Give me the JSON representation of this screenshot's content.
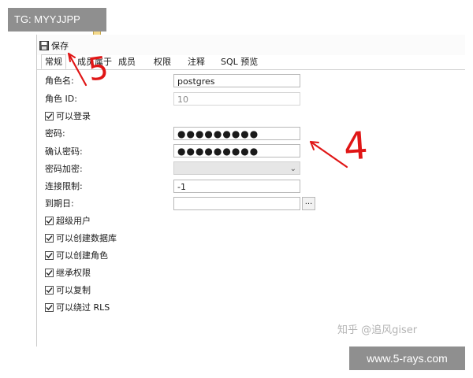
{
  "overlay": {
    "top_left_tag": "TG: MYYJJPP",
    "bottom_right_site": "www.5-rays.com",
    "zhihu_credit": "知乎 @追风giser"
  },
  "toolbar": {
    "save_label": "保存",
    "save_icon": "floppy-disk-icon"
  },
  "tabs": [
    {
      "label": "常规",
      "active": true
    },
    {
      "label": "成员属于",
      "active": false
    },
    {
      "label": "成员",
      "active": false
    },
    {
      "label": "权限",
      "active": false
    },
    {
      "label": "注释",
      "active": false
    },
    {
      "label": "SQL 预览",
      "active": false
    }
  ],
  "form": {
    "role_name_label": "角色名:",
    "role_name_value": "postgres",
    "role_id_label": "角色 ID:",
    "role_id_value": "10",
    "can_login_label": "可以登录",
    "password_label": "密码:",
    "password_value": "●●●●●●●●●",
    "confirm_password_label": "确认密码:",
    "confirm_password_value": "●●●●●●●●●",
    "password_encryption_label": "密码加密:",
    "password_encryption_value": "",
    "connection_limit_label": "连接限制:",
    "connection_limit_value": "-1",
    "expiry_label": "到期日:",
    "expiry_value": "",
    "expiry_button": "...",
    "checkboxes": [
      {
        "label": "超级用户",
        "checked": true
      },
      {
        "label": "可以创建数据库",
        "checked": true
      },
      {
        "label": "可以创建角色",
        "checked": true
      },
      {
        "label": "继承权限",
        "checked": true
      },
      {
        "label": "可以复制",
        "checked": true
      },
      {
        "label": "可以绕过 RLS",
        "checked": true
      }
    ]
  },
  "annotations": {
    "mark_5": "5",
    "mark_4": "4",
    "color": "#e01616"
  }
}
